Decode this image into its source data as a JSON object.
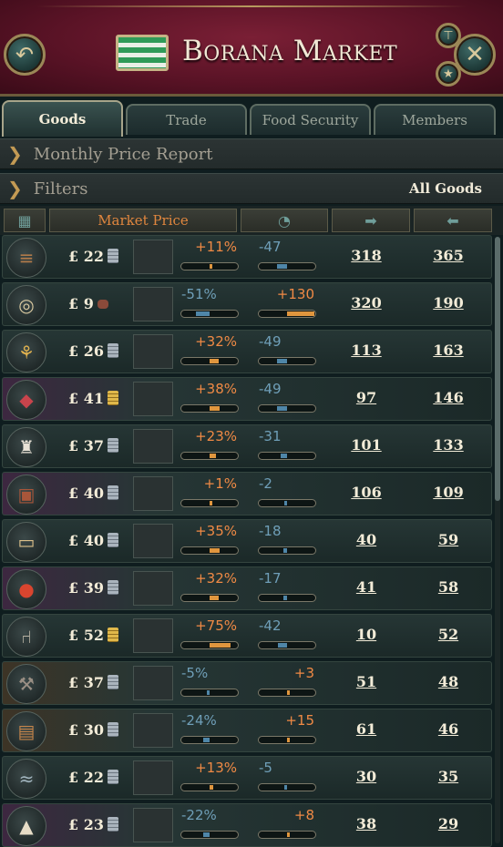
{
  "header": {
    "title": "Borana Market"
  },
  "tabs": [
    {
      "label": "Goods",
      "active": true
    },
    {
      "label": "Trade",
      "active": false
    },
    {
      "label": "Food Security",
      "active": false
    },
    {
      "label": "Members",
      "active": false
    }
  ],
  "sections": {
    "report_label": "Monthly Price Report",
    "filters_label": "Filters",
    "filters_value": "All Goods"
  },
  "columns": {
    "market_price": "Market Price",
    "icons": [
      "grid-icon",
      "clock-icon",
      "export-arrow-icon",
      "import-arrow-icon"
    ]
  },
  "colors": {
    "positive": "#f08a45",
    "negative": "#6f9fb8",
    "accent": "#e0863e"
  },
  "goods": [
    {
      "icon": "wood-logs-icon",
      "price": "£ 22",
      "coin": "silver",
      "pct": "+11%",
      "pct_val": 11,
      "diff": "-47",
      "diff_val": -47,
      "sell": "318",
      "buy": "365",
      "tint": ""
    },
    {
      "icon": "fabric-roll-icon",
      "price": "£ 9",
      "coin": "red",
      "pct": "-51%",
      "pct_val": -51,
      "diff": "+130",
      "diff_val": 130,
      "sell": "320",
      "buy": "190",
      "tint": ""
    },
    {
      "icon": "grain-icon",
      "price": "£ 26",
      "coin": "silver",
      "pct": "+32%",
      "pct_val": 32,
      "diff": "-49",
      "diff_val": -49,
      "sell": "113",
      "buy": "163",
      "tint": ""
    },
    {
      "icon": "meat-icon",
      "price": "£ 41",
      "coin": "gold",
      "pct": "+38%",
      "pct_val": 38,
      "diff": "-49",
      "diff_val": -49,
      "sell": "97",
      "buy": "146",
      "tint": "purple"
    },
    {
      "icon": "clothes-icon",
      "price": "£ 37",
      "coin": "silver",
      "pct": "+23%",
      "pct_val": 23,
      "diff": "-31",
      "diff_val": -31,
      "sell": "101",
      "buy": "133",
      "tint": ""
    },
    {
      "icon": "cigar-box-icon",
      "price": "£ 40",
      "coin": "silver",
      "pct": "+1%",
      "pct_val": 1,
      "diff": "-2",
      "diff_val": -2,
      "sell": "106",
      "buy": "109",
      "tint": "purple"
    },
    {
      "icon": "paper-icon",
      "price": "£ 40",
      "coin": "silver",
      "pct": "+35%",
      "pct_val": 35,
      "diff": "-18",
      "diff_val": -18,
      "sell": "40",
      "buy": "59",
      "tint": ""
    },
    {
      "icon": "fruit-icon",
      "price": "£ 39",
      "coin": "silver",
      "pct": "+32%",
      "pct_val": 32,
      "diff": "-17",
      "diff_val": -17,
      "sell": "41",
      "buy": "58",
      "tint": "purple"
    },
    {
      "icon": "furniture-chair-icon",
      "price": "£ 52",
      "coin": "gold",
      "pct": "+75%",
      "pct_val": 75,
      "diff": "-42",
      "diff_val": -42,
      "sell": "10",
      "buy": "52",
      "tint": ""
    },
    {
      "icon": "tools-icon",
      "price": "£ 37",
      "coin": "silver",
      "pct": "-5%",
      "pct_val": -5,
      "diff": "+3",
      "diff_val": 3,
      "sell": "51",
      "buy": "48",
      "tint": "brown"
    },
    {
      "icon": "planks-icon",
      "price": "£ 30",
      "coin": "silver",
      "pct": "-24%",
      "pct_val": -24,
      "diff": "+15",
      "diff_val": 15,
      "sell": "61",
      "buy": "46",
      "tint": "brown"
    },
    {
      "icon": "fish-icon",
      "price": "£ 22",
      "coin": "silver",
      "pct": "+13%",
      "pct_val": 13,
      "diff": "-5",
      "diff_val": -5,
      "sell": "30",
      "buy": "35",
      "tint": ""
    },
    {
      "icon": "sugar-sack-icon",
      "price": "£ 23",
      "coin": "silver",
      "pct": "-22%",
      "pct_val": -22,
      "diff": "+8",
      "diff_val": 8,
      "sell": "38",
      "buy": "29",
      "tint": "purple"
    }
  ]
}
